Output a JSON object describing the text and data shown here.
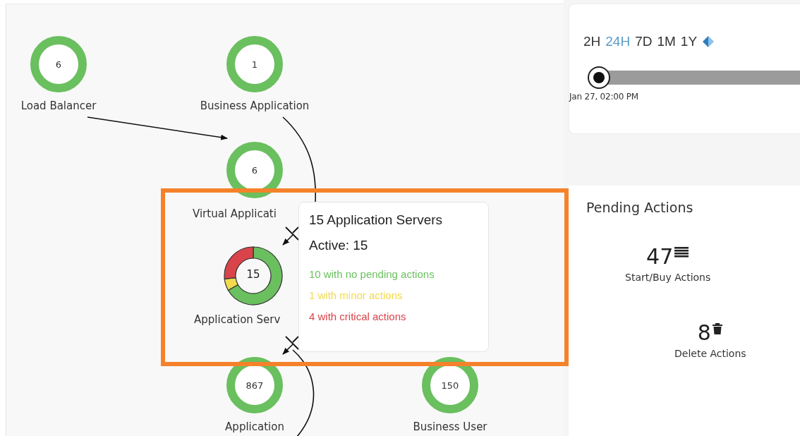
{
  "topology": {
    "nodes": [
      {
        "count": "6",
        "label": "Load Balancer"
      },
      {
        "count": "1",
        "label": "Business Application"
      },
      {
        "count": "6",
        "label": "Virtual Applicati"
      },
      {
        "count": "15",
        "label": "Application Serv",
        "chart_data": {
          "type": "donut",
          "values": [
            66.7,
            6.6,
            26.7
          ]
        }
      },
      {
        "count": "867",
        "label": "Application"
      },
      {
        "count": "150",
        "label": "Business User"
      }
    ]
  },
  "tooltip": {
    "title": "15 Application Servers",
    "subtitle": "Active: 15",
    "lines": [
      {
        "text": "10 with no pending actions",
        "color": "#6abf5e"
      },
      {
        "text": "1 with minor actions",
        "color": "#f2d94e"
      },
      {
        "text": "4 with critical actions",
        "color": "#d9434a"
      }
    ]
  },
  "time_range": {
    "periods": [
      {
        "label": "2H",
        "selected": false
      },
      {
        "label": "24H",
        "selected": true
      },
      {
        "label": "7D",
        "selected": false
      },
      {
        "label": "1M",
        "selected": false
      },
      {
        "label": "1Y",
        "selected": false
      }
    ],
    "slider": {
      "level": 0,
      "reading": "Jan 27, 02:00 PM"
    }
  },
  "pending_actions": {
    "title": "Pending Actions",
    "items": [
      {
        "kind": "start",
        "count": "47",
        "label": "Start/Buy Actions"
      },
      {
        "kind": "delete",
        "count": "8",
        "label": "Delete Actions"
      }
    ]
  }
}
